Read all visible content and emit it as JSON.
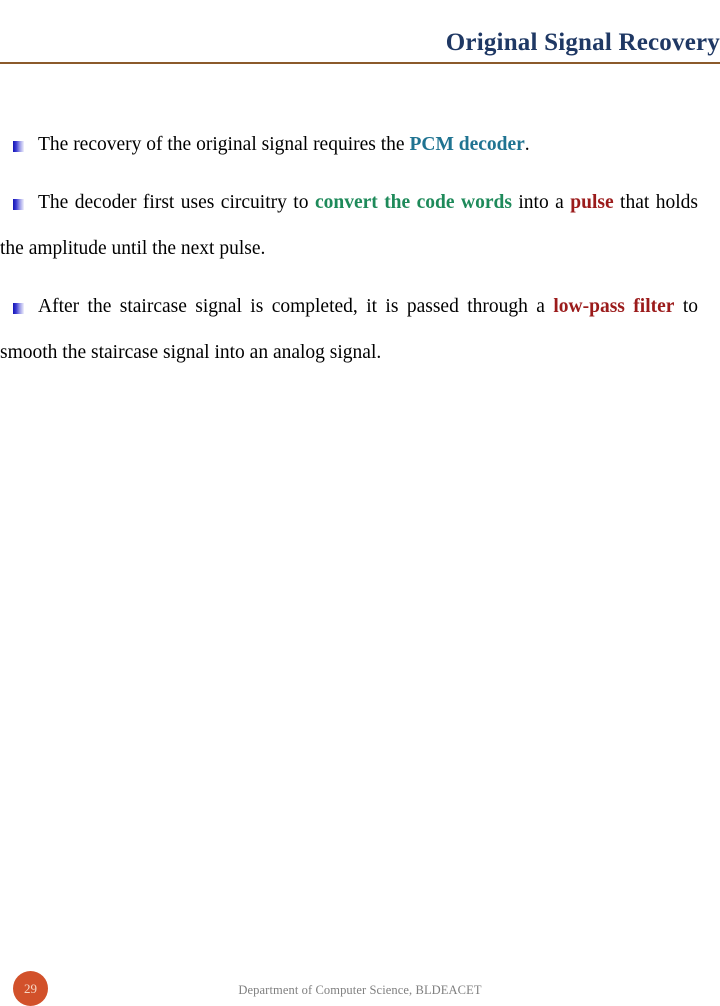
{
  "slide": {
    "title": "Original Signal Recovery",
    "title_color": "#1F3864",
    "rule_color": "#8B5A2B",
    "background": "#ffffff"
  },
  "colors": {
    "accent_teal": "#1F7391",
    "accent_green": "#1E8A5A",
    "accent_red": "#9B1B1B",
    "bullet_blue": "#1414B4",
    "badge_orange": "#D2512A",
    "footer_gray": "#7F7F7F"
  },
  "bullets": [
    {
      "marker": "square-bullet-icon",
      "runs": [
        {
          "text": "The recovery of the original signal requires the ",
          "style": "normal"
        },
        {
          "text": "PCM decoder",
          "style": "teal-bold"
        },
        {
          "text": ".",
          "style": "normal"
        }
      ],
      "plain": "The recovery of the original signal requires the PCM decoder."
    },
    {
      "marker": "square-bullet-icon",
      "runs": [
        {
          "text": "The decoder first uses circuitry to ",
          "style": "normal"
        },
        {
          "text": "convert the code words",
          "style": "green-bold"
        },
        {
          "text": " into a ",
          "style": "normal"
        },
        {
          "text": "pulse",
          "style": "red-bold"
        },
        {
          "text": " that holds the amplitude until the next pulse.",
          "style": "normal"
        }
      ],
      "plain": "The decoder first uses circuitry to convert the code words into a pulse that holds the amplitude until the next pulse."
    },
    {
      "marker": "square-bullet-icon",
      "runs": [
        {
          "text": "After the staircase signal is completed, it is passed through a ",
          "style": "normal"
        },
        {
          "text": "low-pass filter",
          "style": "red-bold"
        },
        {
          "text": " to smooth the staircase signal into an analog signal.",
          "style": "normal"
        }
      ],
      "plain": "After the staircase signal is completed, it is passed through a low-pass filter to smooth the staircase signal into an analog signal."
    }
  ],
  "footer": {
    "page_number": "29",
    "note": "Department of Computer Science, BLDEACET"
  }
}
